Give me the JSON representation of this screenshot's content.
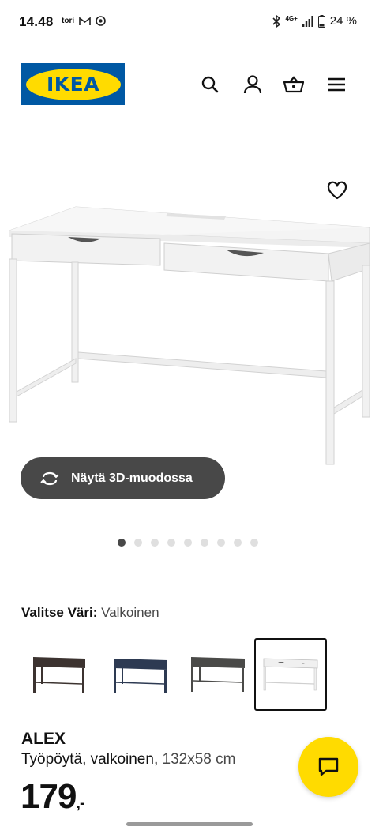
{
  "status_bar": {
    "time": "14.48",
    "left_icons": [
      "tori",
      "gmail-icon",
      "chrome-icon"
    ],
    "network": "4G+",
    "battery": "24 %"
  },
  "header": {
    "logo_text": "IKEA",
    "icons": [
      "search-icon",
      "account-icon",
      "basket-icon",
      "menu-icon"
    ]
  },
  "product_image": {
    "favorite_icon": "heart-icon"
  },
  "view3d": {
    "label": "Näytä 3D-muodossa",
    "icon": "rotate-3d-icon"
  },
  "carousel": {
    "dot_count": 9,
    "active_index": 0
  },
  "color_picker": {
    "label": "Valitse Väri:",
    "value": "Valkoinen",
    "swatches": [
      {
        "color": "#3c3330"
      },
      {
        "color": "#2d3a52"
      },
      {
        "color": "#4a4a48"
      },
      {
        "color": "#f6f6f6",
        "selected": true
      }
    ]
  },
  "product": {
    "name": "ALEX",
    "desc": "Työpöytä, valkoinen,",
    "dimensions": "132x58 cm",
    "price": "179",
    "price_suffix": ",-"
  },
  "colors": {
    "ikea_blue": "#0058a3",
    "ikea_yellow": "#ffdb00",
    "button_dark": "#484848"
  }
}
